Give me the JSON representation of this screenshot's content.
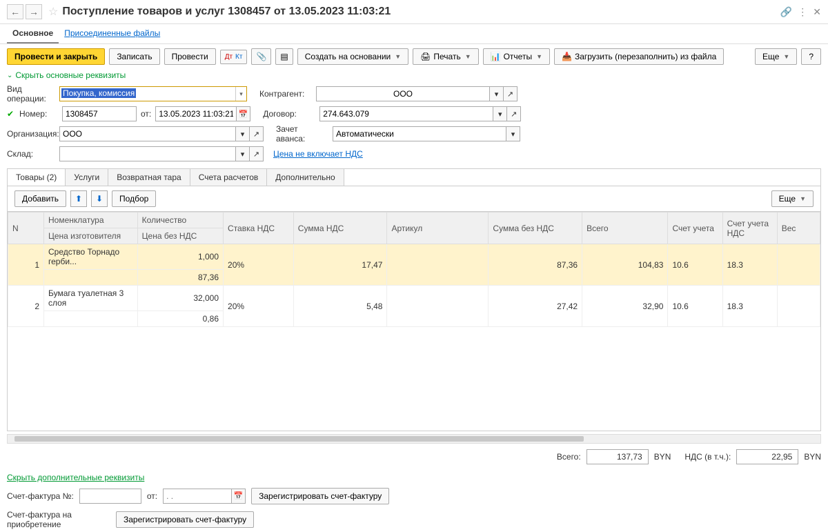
{
  "header": {
    "title": "Поступление товаров и услуг 1308457 от 13.05.2023 11:03:21"
  },
  "tabs": {
    "main": "Основное",
    "attached": "Присоединенные файлы"
  },
  "toolbar": {
    "post_close": "Провести и закрыть",
    "save": "Записать",
    "post": "Провести",
    "create_based": "Создать на основании",
    "print": "Печать",
    "reports": "Отчеты",
    "load_file": "Загрузить (перезаполнить) из файла",
    "more": "Еще",
    "help": "?"
  },
  "collapse": {
    "main_req": "Скрыть основные реквизиты",
    "add_req": "Скрыть дополнительные реквизиты"
  },
  "form": {
    "op_type_label": "Вид операции:",
    "op_type_value": "Покупка, комиссия",
    "number_label": "Номер:",
    "number_value": "1308457",
    "date_label": "от:",
    "date_value": "13.05.2023 11:03:21",
    "org_label": "Организация:",
    "org_value": "ООО",
    "warehouse_label": "Склад:",
    "warehouse_value": "",
    "counterparty_label": "Контрагент:",
    "counterparty_value": "ООО",
    "contract_label": "Договор:",
    "contract_value": "274.643.079",
    "advance_label": "Зачет аванса:",
    "advance_value": "Автоматически",
    "price_no_vat": "Цена не включает НДС"
  },
  "subtabs": {
    "goods": "Товары (2)",
    "services": "Услуги",
    "returnable": "Возвратная тара",
    "accounts": "Счета расчетов",
    "additional": "Дополнительно"
  },
  "subtoolbar": {
    "add": "Добавить",
    "pick": "Подбор",
    "more": "Еще"
  },
  "grid": {
    "headers": {
      "n": "N",
      "nomenclature": "Номенклатура",
      "manufacturer_price": "Цена изготовителя",
      "quantity": "Количество",
      "price_no_vat": "Цена без НДС",
      "vat_rate": "Ставка НДС",
      "vat_amount": "Сумма НДС",
      "article": "Артикул",
      "sum_no_vat": "Сумма без НДС",
      "total": "Всего",
      "account": "Счет учета",
      "vat_account": "Счет учета НДС",
      "weight": "Вес"
    },
    "rows": [
      {
        "n": "1",
        "nomenclature": "Средство Торнадо герби...",
        "quantity": "1,000",
        "price_no_vat": "87,36",
        "vat_rate": "20%",
        "vat_amount": "17,47",
        "article": "",
        "sum_no_vat": "87,36",
        "total": "104,83",
        "account": "10.6",
        "vat_account": "18.3",
        "weight": ""
      },
      {
        "n": "2",
        "nomenclature": "Бумага туалетная 3 слоя",
        "quantity": "32,000",
        "price_no_vat": "0,86",
        "vat_rate": "20%",
        "vat_amount": "5,48",
        "article": "",
        "sum_no_vat": "27,42",
        "total": "32,90",
        "account": "10.6",
        "vat_account": "18.3",
        "weight": ""
      }
    ]
  },
  "totals": {
    "total_label": "Всего:",
    "total_value": "137,73",
    "currency": "BYN",
    "vat_label": "НДС (в т.ч.):",
    "vat_value": "22,95"
  },
  "footer": {
    "invoice_num_label": "Счет-фактура №:",
    "invoice_date_label": "от:",
    "invoice_date_placeholder": ". .",
    "register_invoice": "Зарегистрировать счет-фактуру",
    "purchase_invoice_label": "Счет-фактура на приобретение"
  }
}
